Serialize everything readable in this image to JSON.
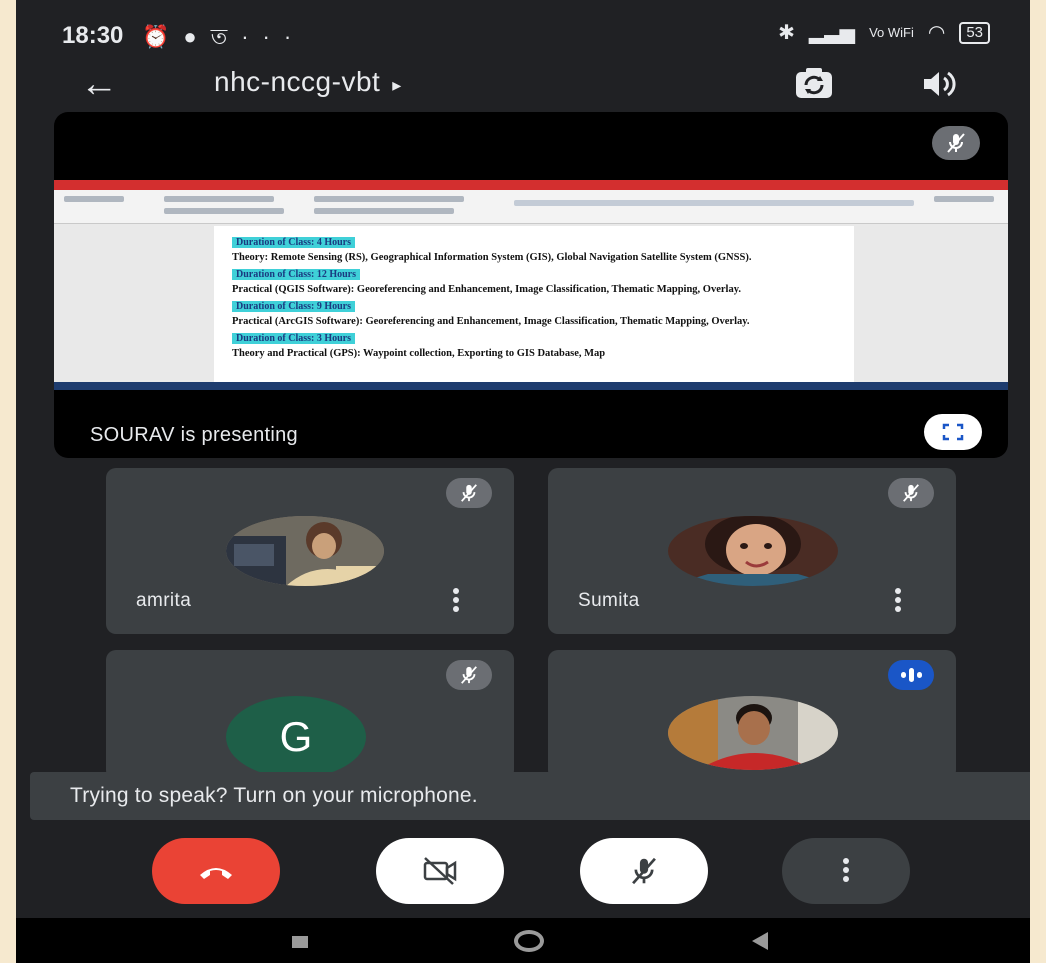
{
  "status_bar": {
    "time": "18:30",
    "left_icons": [
      "alarm-icon",
      "chat-icon",
      "wifi-hotspot-icon",
      "data-icon",
      "more-icon"
    ],
    "signal_label": "Vo WiFi",
    "battery": "53"
  },
  "top_bar": {
    "meeting_code": "nhc-nccg-vbt",
    "play_arrow": "▸"
  },
  "presentation": {
    "presenter_text": "SOURAV is presenting",
    "document": {
      "blocks": [
        {
          "duration": "Duration of Class: 4 Hours",
          "text": "Theory: Remote Sensing (RS), Geographical Information System (GIS), Global Navigation Satellite System (GNSS)."
        },
        {
          "duration": "Duration of Class: 12 Hours",
          "text": "Practical (QGIS Software): Georeferencing and Enhancement, Image Classification, Thematic Mapping, Overlay."
        },
        {
          "duration": "Duration of Class: 9 Hours",
          "text": "Practical (ArcGIS Software): Georeferencing and Enhancement, Image Classification, Thematic Mapping, Overlay."
        },
        {
          "duration": "Duration of Class: 3 Hours",
          "text": "Theory and Practical (GPS): Waypoint collection, Exporting to GIS Database, Map"
        }
      ]
    }
  },
  "participants": [
    {
      "name": "amrita",
      "status": "muted"
    },
    {
      "name": "Sumita",
      "status": "muted"
    },
    {
      "name": "",
      "initial": "G",
      "status": "muted"
    },
    {
      "name": "",
      "status": "speaking"
    }
  ],
  "toast": {
    "text": "Trying to speak? Turn on your microphone."
  },
  "colors": {
    "background": "#202124",
    "tile": "#3c4043",
    "end_call": "#ea4335",
    "speaking": "#1a56c7",
    "initial_avatar": "#1e5f48"
  }
}
